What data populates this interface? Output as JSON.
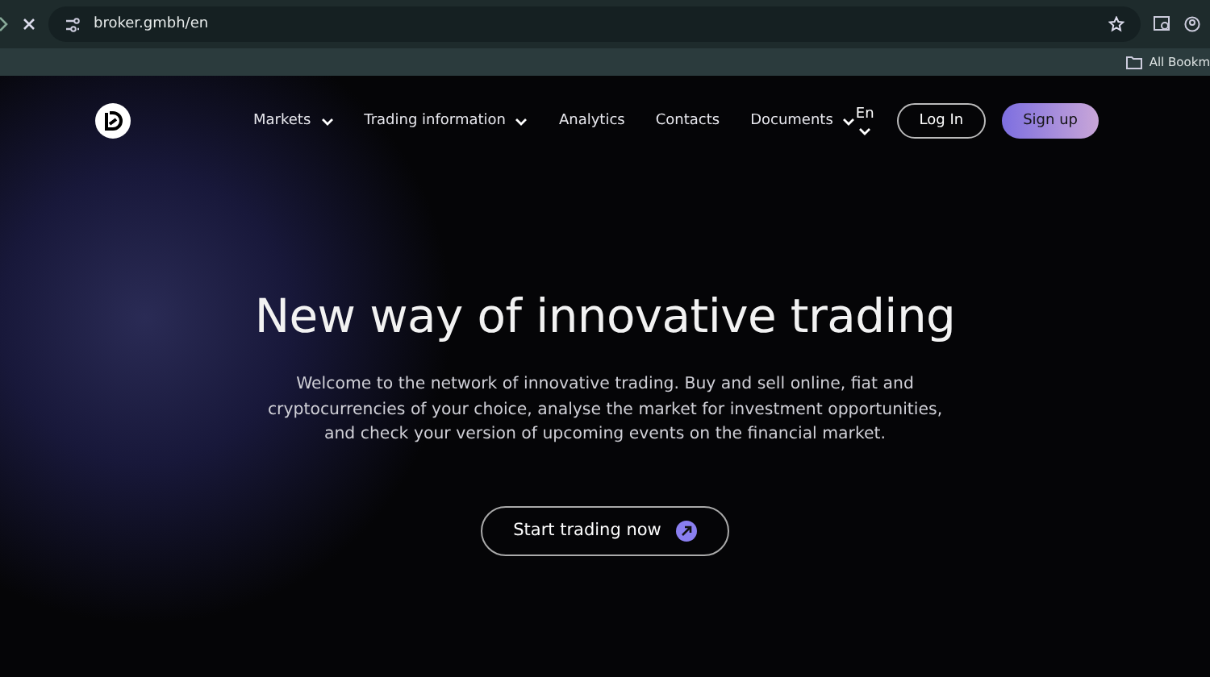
{
  "browser": {
    "url": "broker.gmbh/en",
    "bookmarks_label": "All Bookm"
  },
  "nav": {
    "items": [
      {
        "label": "Markets",
        "has_menu": true
      },
      {
        "label": "Trading information",
        "has_menu": true
      },
      {
        "label": "Analytics",
        "has_menu": false
      },
      {
        "label": "Contacts",
        "has_menu": false
      },
      {
        "label": "Documents",
        "has_menu": true
      }
    ],
    "language": "En",
    "login": "Log In",
    "signup": "Sign up"
  },
  "hero": {
    "title": "New way of innovative trading",
    "text": "Welcome to the network of innovative trading. Buy and sell online, fiat and cryptocurrencies of your choice, analyse the market for investment opportunities, and check your version of upcoming events on the financial market.",
    "cta": "Start trading now"
  }
}
